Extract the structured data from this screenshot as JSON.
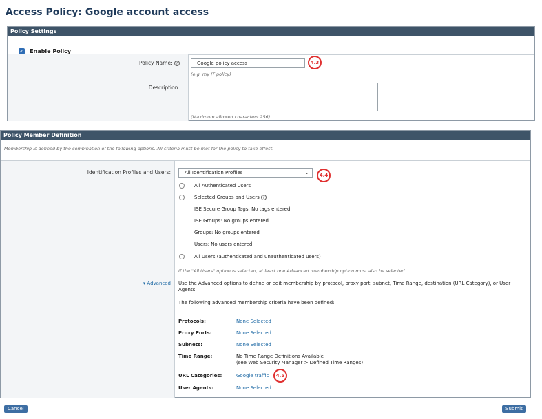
{
  "page": {
    "title": "Access Policy: Google account access"
  },
  "policy_settings": {
    "header": "Policy Settings",
    "enable_label": "Enable Policy",
    "policy_name_label": "Policy Name:",
    "policy_name_value": "Google policy access",
    "policy_name_hint": "(e.g. my IT policy)",
    "description_label": "Description:",
    "description_value": "",
    "description_hint": "(Maximum allowed characters 256)",
    "help_glyph": "?"
  },
  "member_definition": {
    "header": "Policy Member Definition",
    "intro": "Membership is defined by the combination of the following options. All criteria must be met for the policy to take effect.",
    "id_label": "Identification Profiles and Users:",
    "profile_select": "All Identification Profiles",
    "options": {
      "authenticated": "All Authenticated Users",
      "selected_groups": "Selected Groups and Users",
      "ise_tags": "ISE Secure Group Tags: No tags entered",
      "ise_groups": "ISE Groups: No groups entered",
      "groups": "Groups: No groups entered",
      "users": "Users: No users entered",
      "all_users": "All Users (authenticated and unauthenticated users)"
    },
    "all_users_note": "If the \"All Users\" option is selected, at least one Advanced membership option must also be selected.",
    "advanced_toggle": "Advanced",
    "advanced_desc": "Use the Advanced options to define or edit membership by protocol, proxy port, subnet, Time Range, destination (URL Category), or User Agents.",
    "advanced_defined": "The following advanced membership criteria have been defined:",
    "criteria": [
      {
        "label": "Protocols:",
        "value": "None Selected"
      },
      {
        "label": "Proxy Ports:",
        "value": "None Selected"
      },
      {
        "label": "Subnets:",
        "value": "None Selected"
      },
      {
        "label": "Time Range:",
        "value": "No Time Range Definitions Available",
        "value2": "(see Web Security Manager > Defined Time Ranges)"
      },
      {
        "label": "URL Categories:",
        "value": "Google traffic"
      },
      {
        "label": "User Agents:",
        "value": "None Selected"
      }
    ]
  },
  "annotations": [
    "4.3",
    "4.4",
    "4.5"
  ],
  "buttons": {
    "cancel": "Cancel",
    "submit": "Submit"
  },
  "colors": {
    "header": "#3e5468",
    "accent_link": "#1f6aa5",
    "annotation": "#e03030",
    "button": "#3d6ea3"
  }
}
